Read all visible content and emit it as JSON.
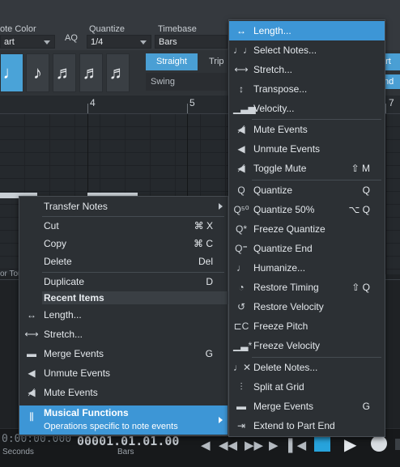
{
  "toolbar": {
    "note_color_label": "ote Color",
    "note_color_value": "art",
    "aq_label": "AQ",
    "quantize_label": "Quantize",
    "quantize_value": "1/4",
    "timebase_label": "Timebase",
    "timebase_value": "Bars",
    "straight_label": "Straight",
    "triplet_label": "Trip",
    "swing_label": "Swing",
    "start_label": "art",
    "nd_label": "nd",
    "note_icons": [
      "♩",
      "♪",
      "♬",
      "♬",
      "♬"
    ]
  },
  "ruler": {
    "marks": [
      "4",
      "5",
      "7"
    ]
  },
  "lower": {
    "track_label": "or Tou"
  },
  "transport": {
    "time_value": "0:00:00.000",
    "time_unit": "Seconds",
    "bars_value": "00001.01.01.00",
    "bars_unit": "Bars"
  },
  "left_menu": {
    "items": [
      {
        "label": "Transfer Notes",
        "shortcut": "",
        "icon": "",
        "submenu": true
      },
      {
        "label": "Cut",
        "shortcut": "⌘ X",
        "icon": ""
      },
      {
        "label": "Copy",
        "shortcut": "⌘ C",
        "icon": ""
      },
      {
        "label": "Delete",
        "shortcut": "Del",
        "icon": ""
      },
      {
        "label": "Duplicate",
        "shortcut": "D",
        "icon": ""
      }
    ],
    "recent_header": "Recent Items",
    "recent": [
      {
        "label": "Length...",
        "shortcut": "",
        "icon": "length-icon"
      },
      {
        "label": "Stretch...",
        "shortcut": "",
        "icon": "stretch-icon"
      },
      {
        "label": "Merge Events",
        "shortcut": "G",
        "icon": "merge-icon"
      },
      {
        "label": "Unmute Events",
        "shortcut": "",
        "icon": "speaker-icon"
      },
      {
        "label": "Mute Events",
        "shortcut": "",
        "icon": "mute-icon"
      }
    ],
    "musical_functions": {
      "label": "Musical Functions",
      "description": "Operations specific to note events"
    }
  },
  "right_menu": {
    "items": [
      {
        "label": "Length...",
        "shortcut": "",
        "icon": "length-icon"
      },
      {
        "label": "Select Notes...",
        "shortcut": "",
        "icon": "notes-icon"
      },
      {
        "label": "Stretch...",
        "shortcut": "",
        "icon": "stretch-icon"
      },
      {
        "label": "Transpose...",
        "shortcut": "",
        "icon": "transpose-icon"
      },
      {
        "label": "Velocity...",
        "shortcut": "",
        "icon": "velocity-icon"
      },
      {
        "label": "Mute Events",
        "shortcut": "",
        "icon": "mute-icon"
      },
      {
        "label": "Unmute Events",
        "shortcut": "",
        "icon": "speaker-icon"
      },
      {
        "label": "Toggle Mute",
        "shortcut": "⇧ M",
        "icon": "toggle-mute-icon"
      },
      {
        "label": "Quantize",
        "shortcut": "Q",
        "icon": "quantize-icon"
      },
      {
        "label": "Quantize 50%",
        "shortcut": "⌥ Q",
        "icon": "quantize-50-icon"
      },
      {
        "label": "Freeze Quantize",
        "shortcut": "",
        "icon": "freeze-quantize-icon"
      },
      {
        "label": "Quantize End",
        "shortcut": "",
        "icon": "quantize-end-icon"
      },
      {
        "label": "Humanize...",
        "shortcut": "",
        "icon": "humanize-icon"
      },
      {
        "label": "Restore Timing",
        "shortcut": "⇧ Q",
        "icon": "restore-timing-icon"
      },
      {
        "label": "Restore Velocity",
        "shortcut": "",
        "icon": "restore-velocity-icon"
      },
      {
        "label": "Freeze Pitch",
        "shortcut": "",
        "icon": "freeze-pitch-icon"
      },
      {
        "label": "Freeze Velocity",
        "shortcut": "",
        "icon": "freeze-velocity-icon"
      },
      {
        "label": "Delete Notes...",
        "shortcut": "",
        "icon": "delete-notes-icon"
      },
      {
        "label": "Split at Grid",
        "shortcut": "",
        "icon": "split-icon"
      },
      {
        "label": "Merge Events",
        "shortcut": "G",
        "icon": "merge-icon"
      },
      {
        "label": "Extend to Part End",
        "shortcut": "",
        "icon": "extend-icon"
      }
    ]
  },
  "colors": {
    "accent": "#3d96d6",
    "menu_bg": "#2c3034"
  }
}
